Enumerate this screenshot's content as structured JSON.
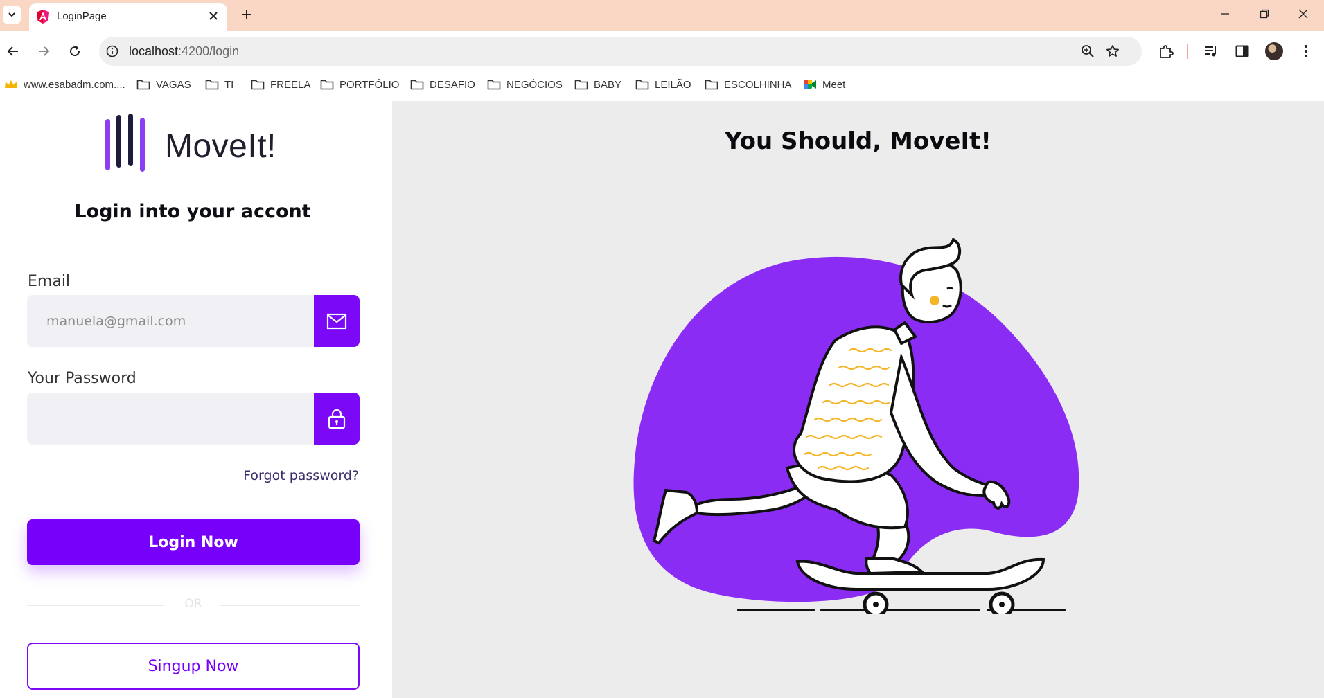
{
  "browser": {
    "tab_title": "LoginPage",
    "url_host": "localhost",
    "url_path": ":4200/login",
    "bookmarks": [
      {
        "label": "www.esabadm.com....",
        "icon": "crown-icon"
      },
      {
        "label": "VAGAS",
        "icon": "folder-icon"
      },
      {
        "label": "TI",
        "icon": "folder-icon"
      },
      {
        "label": "FREELA",
        "icon": "folder-icon"
      },
      {
        "label": "PORTFÓLIO",
        "icon": "folder-icon"
      },
      {
        "label": "DESAFIO",
        "icon": "folder-icon"
      },
      {
        "label": "NEGÓCIOS",
        "icon": "folder-icon"
      },
      {
        "label": "BABY",
        "icon": "folder-icon"
      },
      {
        "label": "LEILÃO",
        "icon": "folder-icon"
      },
      {
        "label": "ESCOLHINHA",
        "icon": "folder-icon"
      },
      {
        "label": "Meet",
        "icon": "meet-icon"
      }
    ]
  },
  "brand": {
    "name": "MoveIt!",
    "accent": "#7700fb",
    "dark_bar": "#1f1b3d"
  },
  "login": {
    "heading": "Login into your accont",
    "email_label": "Email",
    "email_placeholder": "manuela@gmail.com",
    "email_value": "",
    "password_label": "Your Password",
    "password_value": "",
    "forgot_label": "Forgot password?",
    "login_button": "Login Now",
    "or_text": "OR",
    "signup_button": "Singup Now"
  },
  "hero": {
    "title": "You Should, MoveIt!",
    "illustration": "skateboarder-illustration"
  }
}
